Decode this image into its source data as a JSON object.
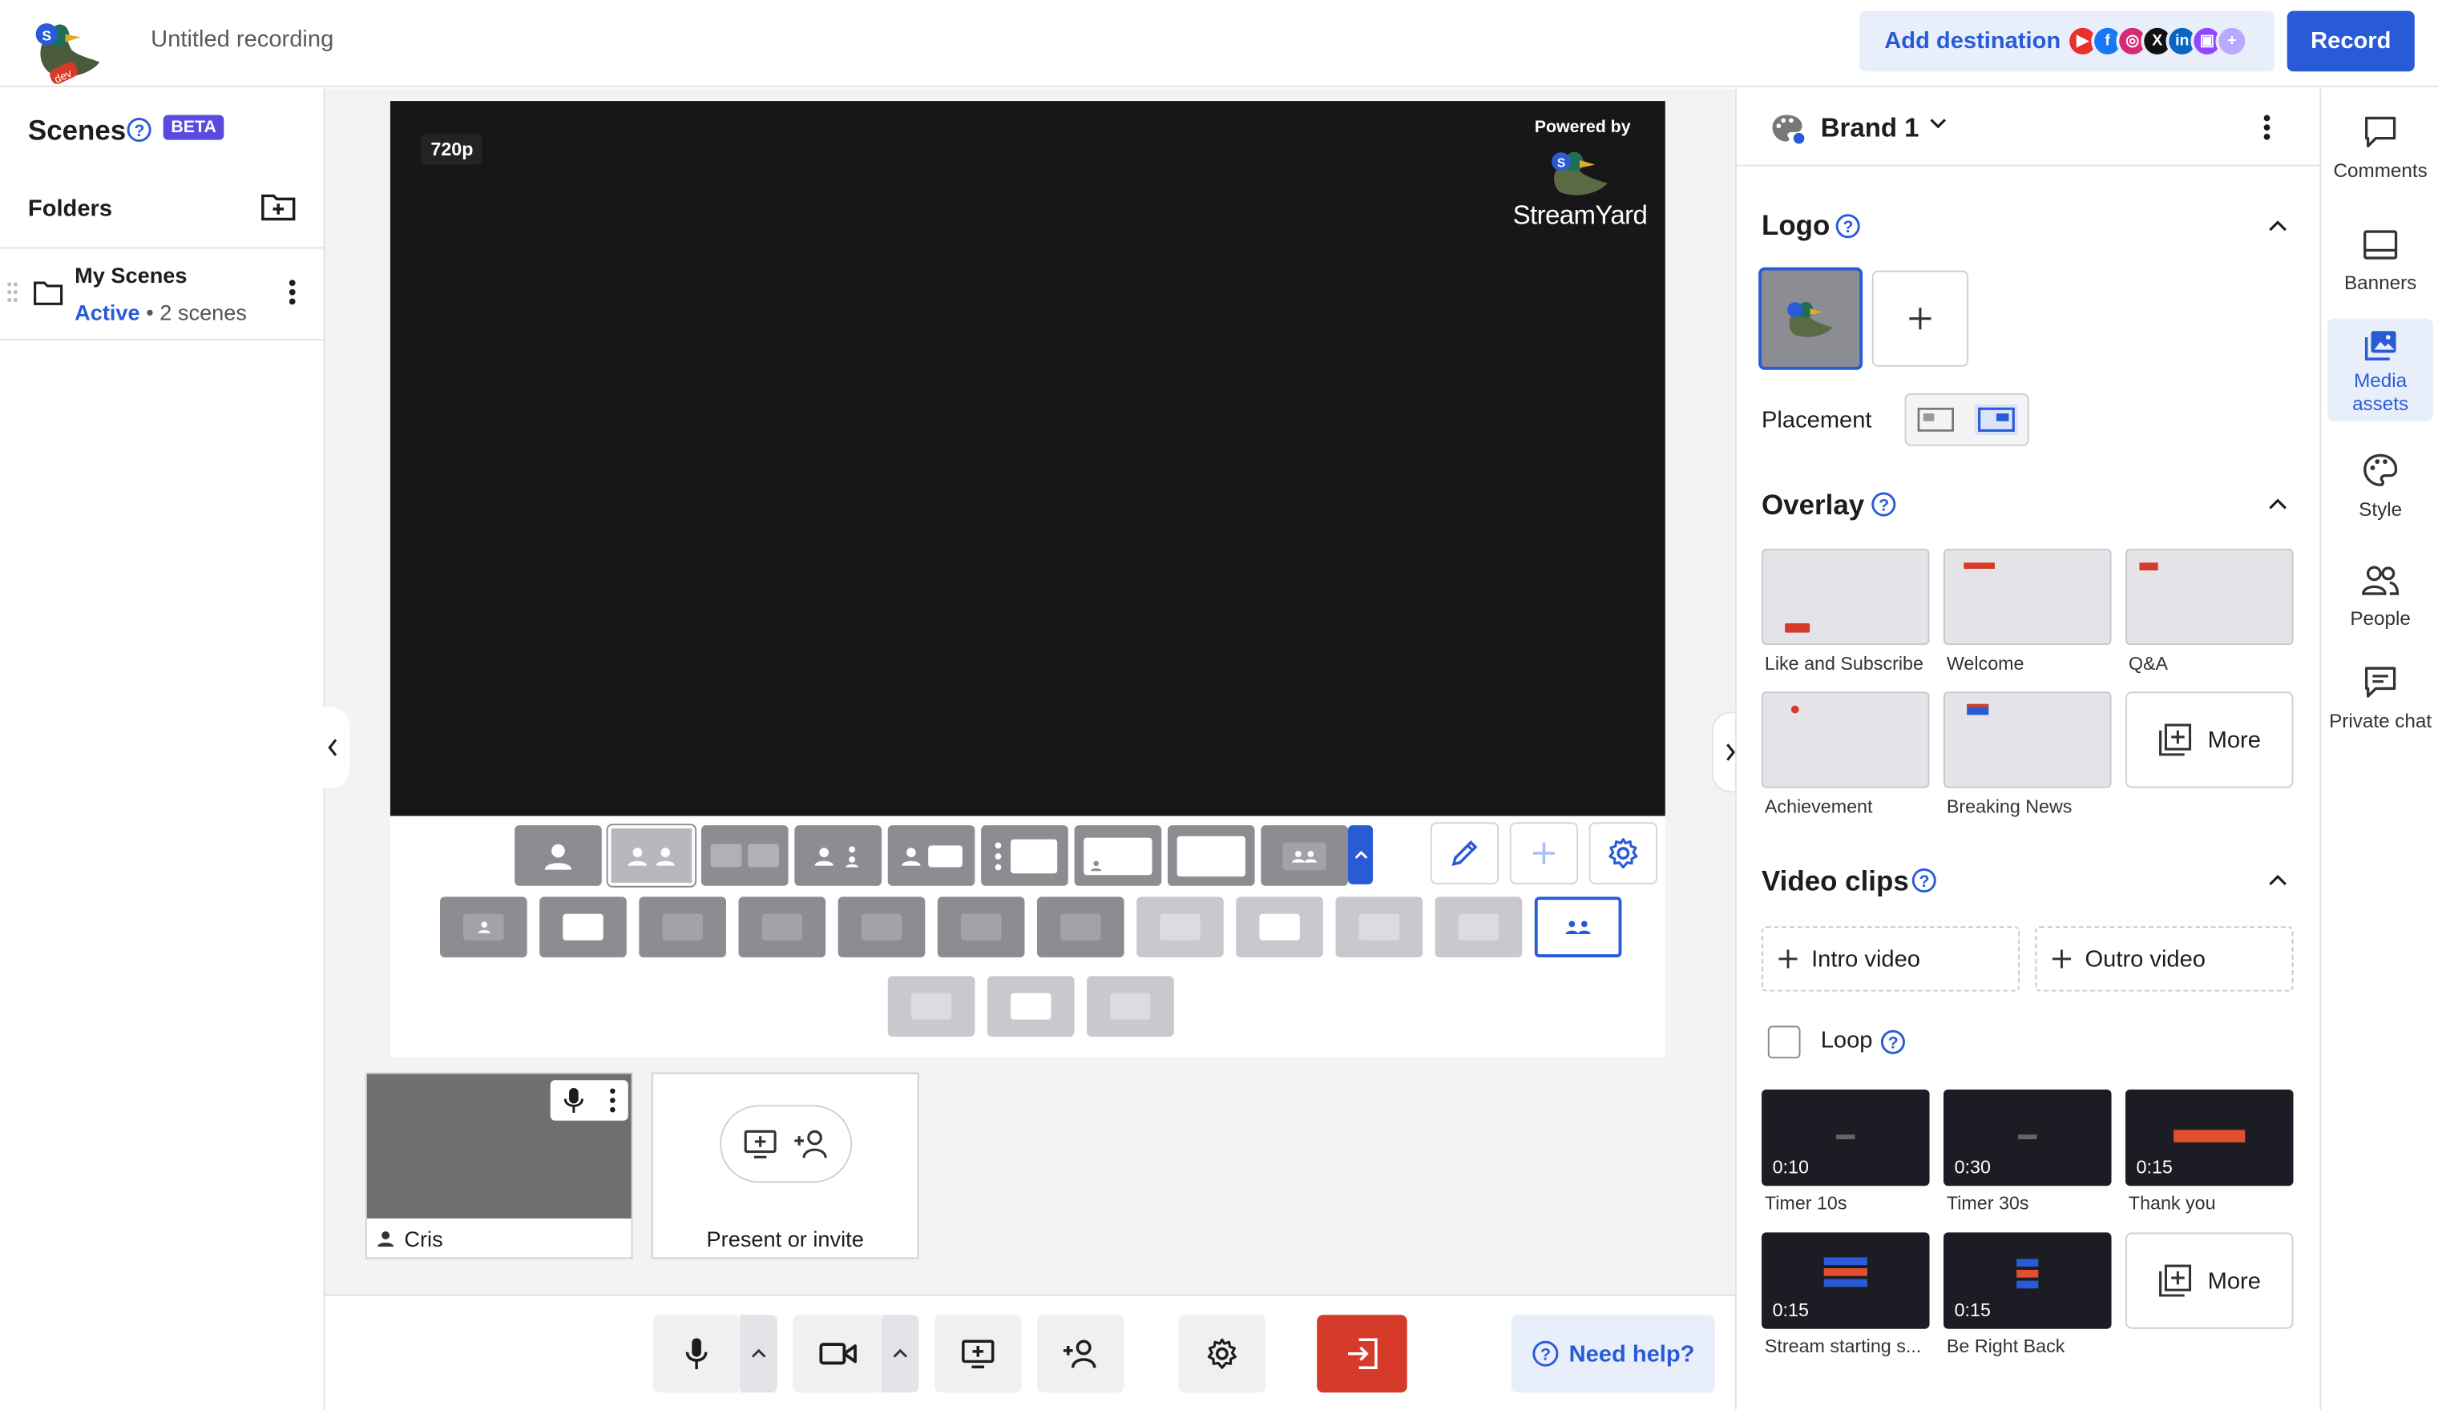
{
  "app": {
    "recording_title": "Untitled recording"
  },
  "topbar": {
    "add_destination_label": "Add destination",
    "destinations": [
      {
        "icon": "youtube-icon",
        "color": "#e8302d"
      },
      {
        "icon": "facebook-icon",
        "color": "#1877f2"
      },
      {
        "icon": "instagram-icon",
        "color": "#d62976"
      },
      {
        "icon": "x-icon",
        "color": "#111111"
      },
      {
        "icon": "linkedin-icon",
        "color": "#0a66c2"
      },
      {
        "icon": "twitch-icon",
        "color": "#9146ff"
      },
      {
        "icon": "add-destination-icon",
        "color": "#b9a9ff"
      }
    ],
    "record_label": "Record"
  },
  "scenes": {
    "title": "Scenes",
    "badge": "BETA",
    "folders_title": "Folders",
    "folder": {
      "name": "My Scenes",
      "status": "Active",
      "count": "• 2 scenes"
    }
  },
  "stage": {
    "resolution": "720p",
    "watermark_powered": "Powered by",
    "watermark_brand": "StreamYard"
  },
  "participants": {
    "cam_name": "Cris",
    "invite_label": "Present or invite"
  },
  "bottombar": {
    "help_label": "Need help?",
    "leave_color": "#d63b2a"
  },
  "brand": {
    "name": "Brand 1",
    "logo_section": "Logo",
    "placement_label": "Placement",
    "overlay_section": "Overlay",
    "overlays": [
      {
        "label": "Like and Subscribe"
      },
      {
        "label": "Welcome"
      },
      {
        "label": "Q&A"
      },
      {
        "label": "Achievement"
      },
      {
        "label": "Breaking News"
      }
    ],
    "more_label": "More",
    "video_section": "Video clips",
    "intro_label": "Intro video",
    "outro_label": "Outro video",
    "loop_label": "Loop",
    "clips": [
      {
        "label": "Timer 10s",
        "duration": "0:10"
      },
      {
        "label": "Timer 30s",
        "duration": "0:30"
      },
      {
        "label": "Thank you",
        "duration": "0:15"
      },
      {
        "label": "Stream starting s...",
        "duration": "0:15"
      },
      {
        "label": "Be Right Back",
        "duration": "0:15"
      }
    ],
    "clip_more_label": "More"
  },
  "sidenav": [
    {
      "label": "Comments",
      "icon": "comments-icon"
    },
    {
      "label": "Banners",
      "icon": "banners-icon"
    },
    {
      "label": "Media assets",
      "icon": "media-assets-icon",
      "active": true
    },
    {
      "label": "Style",
      "icon": "style-icon"
    },
    {
      "label": "People",
      "icon": "people-icon"
    },
    {
      "label": "Private chat",
      "icon": "private-chat-icon"
    }
  ]
}
